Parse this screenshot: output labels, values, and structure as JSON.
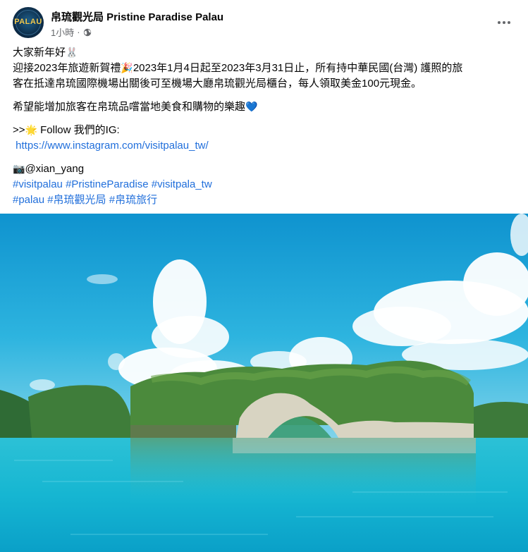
{
  "page": {
    "name": "帛琉觀光局 Pristine Paradise Palau",
    "avatar_text": "PALAU",
    "time": "1小時",
    "separator": "·"
  },
  "post": {
    "greeting": "大家新年好",
    "greeting_emoji": "🐰",
    "line1a": "迎接2023年旅遊新賀禮",
    "line1_emoji": "🎉",
    "line1b": "2023年1月4日起至2023年3月31日止，所有持中華民國(台灣) 護照的旅",
    "line2": "客在抵達帛琉國際機場出關後可至機場大廳帛琉觀光局櫃台，每人領取美金100元現金。",
    "line3": "希望能增加旅客在帛琉品嚐當地美食和購物的樂趣",
    "line3_emoji": "💙",
    "follow_prefix": ">>",
    "follow_emoji": "🌟",
    "follow_text": " Follow 我們的IG:",
    "ig_link": "https://www.instagram.com/visitpalau_tw/",
    "credit_emoji": "📷",
    "credit": "@xian_yang",
    "hashtags_line1": [
      "#visitpalau",
      "#PristineParadise",
      "#visitpala_tw"
    ],
    "hashtags_line2": [
      "#palau",
      "#帛琉觀光局",
      "#帛琉旅行"
    ]
  },
  "icons": {
    "globe": "globe-icon",
    "more": "more-options-icon"
  },
  "colors": {
    "link": "#216fdb",
    "secondary_text": "#65676b",
    "sky": "#1aa6d6",
    "water": "#19b9d4"
  }
}
